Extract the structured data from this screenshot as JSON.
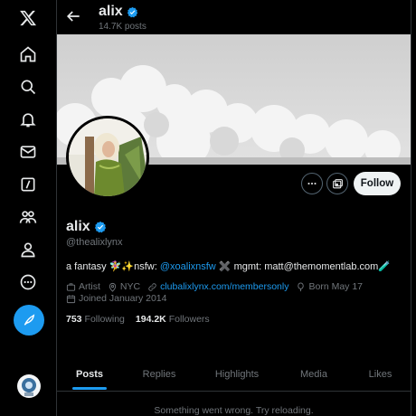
{
  "topbar": {
    "name": "alix",
    "post_count": "14.7K posts"
  },
  "profile": {
    "name": "alix",
    "handle": "@thealixlynx",
    "follow_label": "Follow",
    "bio": {
      "prefix": "a fantasy ",
      "emoji1": "🧚‍♀️✨",
      "nsfw_label": "nsfw: ",
      "nsfw_handle": "@xoalixnsfw",
      "cross": " ✖️ ",
      "mgmt": "mgmt: matt@themomentlab.com",
      "pill": "🧪"
    },
    "category": "Artist",
    "location": "NYC",
    "website": "clubalixlynx.com/membersonly",
    "birthday": "Born May 17",
    "joined": "Joined January 2014",
    "following_count": "753",
    "following_label": "Following",
    "followers_count": "194.2K",
    "followers_label": "Followers"
  },
  "tabs": [
    "Posts",
    "Replies",
    "Highlights",
    "Media",
    "Likes"
  ],
  "error_message": "Something went wrong. Try reloading.",
  "colors": {
    "accent": "#1d9bf0",
    "background": "#000000",
    "muted": "#71767b",
    "verified": "#1d9bf0"
  },
  "icons": {
    "sidebar": [
      "x-logo-icon",
      "home-icon",
      "search-icon",
      "notifications-icon",
      "messages-icon",
      "grok-icon",
      "communities-icon",
      "profile-icon",
      "more-icon"
    ],
    "post": "feather-icon"
  }
}
